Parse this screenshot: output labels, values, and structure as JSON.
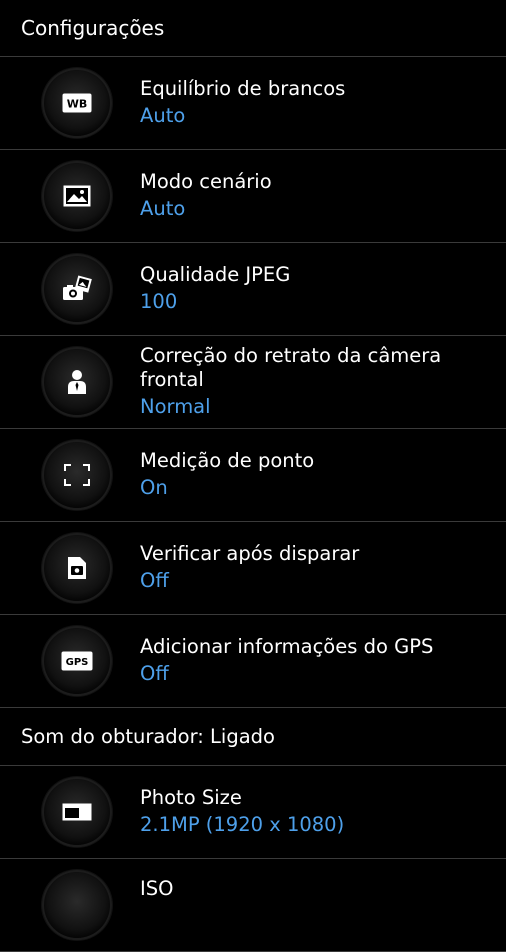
{
  "header": {
    "title": "Configurações"
  },
  "items": [
    {
      "title": "Equilíbrio de brancos",
      "value": "Auto",
      "icon": "white-balance-icon",
      "icon_text": "WB"
    },
    {
      "title": "Modo cenário",
      "value": "Auto",
      "icon": "scene-mode-icon"
    },
    {
      "title": "Qualidade JPEG",
      "value": "100",
      "icon": "jpeg-quality-icon"
    },
    {
      "title": "Correção do retrato da câmera frontal",
      "value": "Normal",
      "icon": "portrait-icon"
    },
    {
      "title": "Medição de ponto",
      "value": "On",
      "icon": "spot-metering-icon"
    },
    {
      "title": "Verificar após disparar",
      "value": "Off",
      "icon": "review-icon"
    },
    {
      "title": "Adicionar informações do GPS",
      "value": "Off",
      "icon": "gps-icon",
      "icon_text": "GPS"
    }
  ],
  "section": {
    "title": "Som do obturador: Ligado"
  },
  "items2": [
    {
      "title": "Photo Size",
      "value": "2.1MP (1920 x 1080)",
      "icon": "photo-size-icon"
    },
    {
      "title": "ISO",
      "icon": "iso-icon"
    }
  ],
  "colors": {
    "accent": "#4ea0ea",
    "background": "#000000",
    "divider": "#3a3a3a"
  }
}
